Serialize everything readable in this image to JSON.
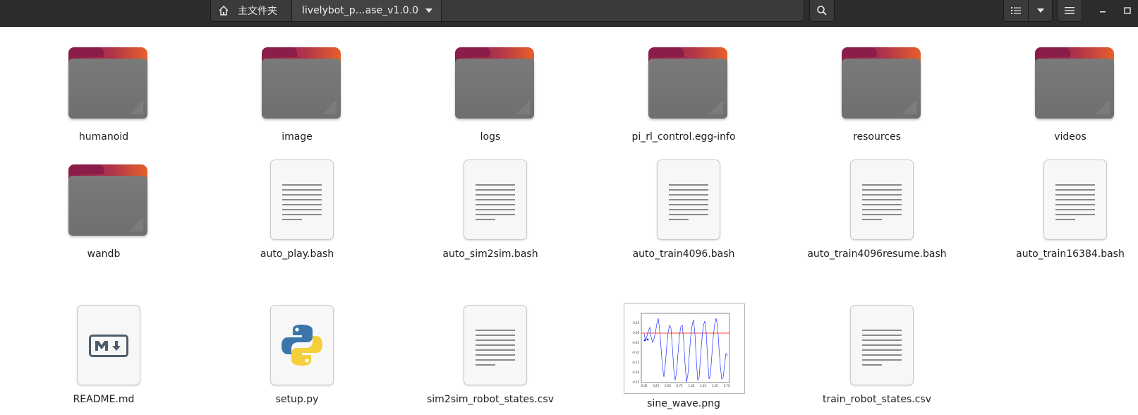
{
  "header": {
    "home_label": "主文件夹",
    "current_folder": "livelybot_p…ase_v1.0.0"
  },
  "icons": {
    "home": "home-icon",
    "search": "search-icon",
    "view": "list-view-icon",
    "menu": "hamburger-menu-icon",
    "minimize": "minimize-icon",
    "maximize": "maximize-icon"
  },
  "colors": {
    "headerbar": "#2c2c2c",
    "folder_tab_gradient": [
      "#8b1e4b",
      "#e7602a"
    ],
    "folder_body": "#757575",
    "python_blue": "#3b75aa",
    "python_yellow": "#f5cf3b",
    "plot_line": "#2233ff",
    "plot_zero_line": "#ff0000"
  },
  "files": [
    {
      "name": "humanoid",
      "type": "folder"
    },
    {
      "name": "image",
      "type": "folder"
    },
    {
      "name": "logs",
      "type": "folder"
    },
    {
      "name": "pi_rl_control.egg-info",
      "type": "folder"
    },
    {
      "name": "resources",
      "type": "folder"
    },
    {
      "name": "videos",
      "type": "folder"
    },
    {
      "name": "wandb",
      "type": "folder"
    },
    {
      "name": "auto_play.bash",
      "type": "text"
    },
    {
      "name": "auto_sim2sim.bash",
      "type": "text"
    },
    {
      "name": "auto_train4096.bash",
      "type": "text"
    },
    {
      "name": "auto_train4096resume.bash",
      "type": "text"
    },
    {
      "name": "auto_train16384.bash",
      "type": "text"
    },
    {
      "name": "README.md",
      "type": "markdown"
    },
    {
      "name": "setup.py",
      "type": "python"
    },
    {
      "name": "sim2sim_robot_states.csv",
      "type": "text"
    },
    {
      "name": "sine_wave.png",
      "type": "image"
    },
    {
      "name": "train_robot_states.csv",
      "type": "text"
    }
  ],
  "sine_thumb": {
    "y_ticks": [
      "0.05",
      "0.00",
      "-0.05",
      "-0.10",
      "-0.15",
      "-0.20",
      "-0.25"
    ],
    "x_ticks": [
      "0.00",
      "0.25",
      "0.50",
      "0.75",
      "1.00",
      "1.25",
      "1.50",
      "1.75"
    ]
  }
}
